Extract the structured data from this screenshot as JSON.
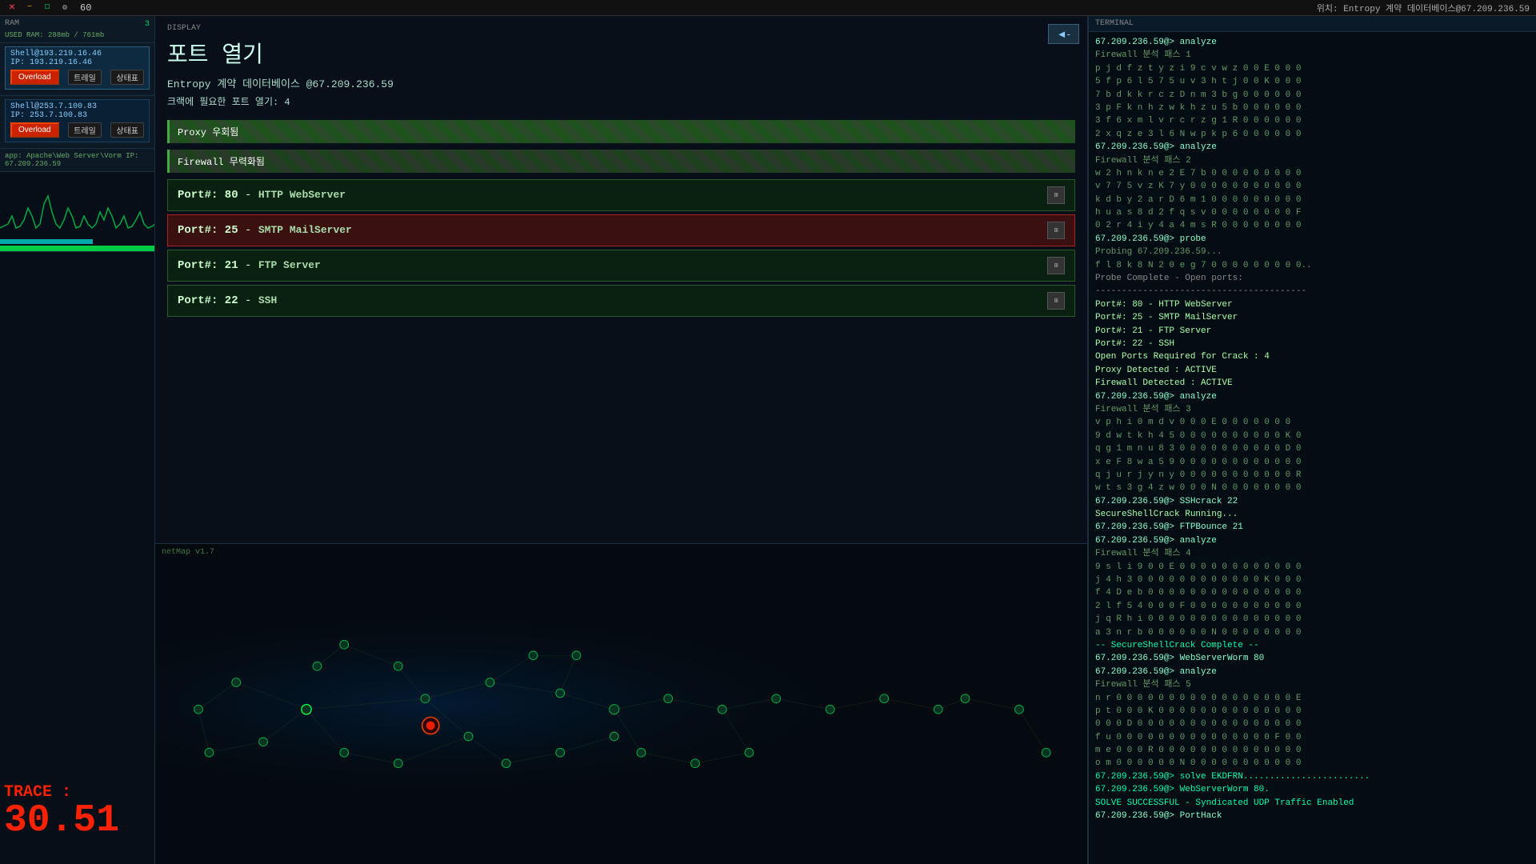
{
  "topbar": {
    "icons": [
      "×",
      "−",
      "□",
      "⚙"
    ],
    "counter": "60",
    "right_text": "위치: Entropy 계약 데이터베이스@67.209.236.59"
  },
  "sidebar": {
    "section_ram": "RAM",
    "ram_used": "USED RAM: 288mb / 761mb",
    "ram_number": "3",
    "host1": {
      "ip": "IP: 193.219.16.46",
      "name": "Shell@193.219.16.46"
    },
    "host2": {
      "ip": "IP: 253.7.100.83",
      "name": "Shell@253.7.100.83"
    },
    "btn_overload": "Overload",
    "btn_trace": "트레일",
    "btn_status": "상태표",
    "app_info": "app: Apache\\Web Server\\Vorm IP: 67.209.236.59"
  },
  "display": {
    "section_label": "DISPLAY",
    "title": "포트 열기",
    "target": "Entropy 계약 데이터베이스 @67.209.236.59",
    "crack_info": "크랙에 필요한 포트 열기: 4",
    "back_btn": "◄-",
    "proxy_label": "Proxy 우회됨",
    "firewall_label": "Firewall 무력화됨",
    "ports": [
      {
        "num": "80",
        "service": "HTTP WebServer",
        "active": false
      },
      {
        "num": "25",
        "service": "SMTP MailServer",
        "active": true
      },
      {
        "num": "21",
        "service": "FTP Server",
        "active": false
      },
      {
        "num": "22",
        "service": "SSH",
        "active": false
      }
    ]
  },
  "netmap": {
    "label": "netMap v1.7",
    "trace_label": "TRACE :",
    "trace_value": "30.51"
  },
  "terminal": {
    "section_label": "TERMINAL",
    "header_text": "위치: Entropy 계약 데이터베이스@67.209.236.59",
    "lines": [
      {
        "type": "cmd",
        "text": "67.209.236.59@> analyze"
      },
      {
        "type": "output",
        "text": "Firewall 분석 패스 1"
      },
      {
        "type": "output",
        "text": "p j d f z t y z i 9 c v w z 0 0 E 0 0 0"
      },
      {
        "type": "output",
        "text": "5 f p 6 l 5 7 5 u v 3 h t j 0 0 K 0 0 0"
      },
      {
        "type": "output",
        "text": "7 b d k k r c z D n m 3 b g 0 0 0 0 0 0"
      },
      {
        "type": "output",
        "text": "3 p F k n h z w k h z u 5 b 0 0 0 0 0 0"
      },
      {
        "type": "output",
        "text": "3 f 6 x m l v r c r z g 1 R 0 0 0 0 0 0"
      },
      {
        "type": "output",
        "text": "2 x q z e 3 l 6 N w p k p 6 0 0 0 0 0 0"
      },
      {
        "type": "cmd",
        "text": "67.209.236.59@> analyze"
      },
      {
        "type": "output",
        "text": "Firewall 분석 패스 2"
      },
      {
        "type": "output",
        "text": "w 2 h n k n e 2 E 7 b 0 0 0 0 0 0 0 0 0"
      },
      {
        "type": "output",
        "text": "v 7 7 5 v z K 7 y 0 0 0 0 0 0 0 0 0 0 0"
      },
      {
        "type": "output",
        "text": "k d b y 2 a r D 6 m 1 0 0 0 0 0 0 0 0 0"
      },
      {
        "type": "output",
        "text": "h u a s 8 d 2 f q s v 0 0 0 0 0 0 0 0 F"
      },
      {
        "type": "output",
        "text": "0 2 r 4 i y 4 a 4 m s R 0 0 0 0 0 0 0 0"
      },
      {
        "type": "cmd",
        "text": "67.209.236.59@> probe"
      },
      {
        "type": "output",
        "text": "Probing 67.209.236.59..."
      },
      {
        "type": "output",
        "text": "f l 8 k 8 N 2 0 e g 7 0 0 0 0 0 0 0 0 0.."
      },
      {
        "type": "section",
        "text": "Probe Complete - Open ports:"
      },
      {
        "type": "section",
        "text": "----------------------------------------"
      },
      {
        "type": "highlight",
        "text": "Port#: 80  -  HTTP WebServer"
      },
      {
        "type": "highlight",
        "text": "Port#: 25  -  SMTP MailServer"
      },
      {
        "type": "highlight",
        "text": "Port#: 21  -  FTP Server"
      },
      {
        "type": "highlight",
        "text": "Port#: 22  -  SSH"
      },
      {
        "type": "section",
        "text": ""
      },
      {
        "type": "highlight",
        "text": "Open Ports Required for Crack : 4"
      },
      {
        "type": "highlight",
        "text": "Proxy Detected : ACTIVE"
      },
      {
        "type": "highlight",
        "text": "Firewall Detected : ACTIVE"
      },
      {
        "type": "cmd",
        "text": "67.209.236.59@> analyze"
      },
      {
        "type": "output",
        "text": "Firewall 분석 패스 3"
      },
      {
        "type": "output",
        "text": "v p h i 0 m d v 0 0 0 E 0 0 0 0 0 0 0"
      },
      {
        "type": "output",
        "text": "9 d w t k h 4 5 0 0 0 0 0 0 0 0 0 0 K 0"
      },
      {
        "type": "output",
        "text": "q g 1 m n u 8 3 0 0 0 0 0 0 0 0 0 0 D 0"
      },
      {
        "type": "output",
        "text": "x e F 8 w a 5 9 0 0 0 0 0 0 0 0 0 0 0 0"
      },
      {
        "type": "output",
        "text": "q j u r j y n y 0 0 0 0 0 0 0 0 0 0 0 R"
      },
      {
        "type": "output",
        "text": "w t s 3 g 4 z w 0 0 0 N 0 0 0 0 0 0 0 0"
      },
      {
        "type": "cmd",
        "text": "67.209.236.59@> SSHcrack 22"
      },
      {
        "type": "highlight",
        "text": "SecureShellCrack Running..."
      },
      {
        "type": "cmd",
        "text": "67.209.236.59@> FTPBounce 21"
      },
      {
        "type": "cmd",
        "text": "67.209.236.59@> analyze"
      },
      {
        "type": "output",
        "text": "Firewall 분석 패스 4"
      },
      {
        "type": "output",
        "text": "9 s l i 9 0 0 E 0 0 0 0 0 0 0 0 0 0 0 0"
      },
      {
        "type": "output",
        "text": "j 4 h 3 0 0 0 0 0 0 0 0 0 0 0 0 K 0 0 0"
      },
      {
        "type": "output",
        "text": "f 4 D e b 0 0 0 0 0 0 0 0 0 0 0 0 0 0 0"
      },
      {
        "type": "output",
        "text": "2 l f 5 4 0 0 0 F 0 0 0 0 0 0 0 0 0 0 0"
      },
      {
        "type": "output",
        "text": "j q R h i 0 0 0 0 0 0 0 0 0 0 0 0 0 0 0"
      },
      {
        "type": "output",
        "text": "a 3 n r b 0 0 0 0 0 0 N 0 0 0 0 0 0 0 0"
      },
      {
        "type": "section",
        "text": ""
      },
      {
        "type": "success",
        "text": "-- SecureShellCrack Complete --"
      },
      {
        "type": "cmd",
        "text": "67.209.236.59@> WebServerWorm 80"
      },
      {
        "type": "cmd",
        "text": "67.209.236.59@> analyze"
      },
      {
        "type": "output",
        "text": "Firewall 분석 패스 5"
      },
      {
        "type": "output",
        "text": "n r 0 0 0 0 0 0 0 0 0 0 0 0 0 0 0 0 0 E"
      },
      {
        "type": "output",
        "text": "p t 0 0 0 K 0 0 0 0 0 0 0 0 0 0 0 0 0 0"
      },
      {
        "type": "output",
        "text": "0 0 0 D 0 0 0 0 0 0 0 0 0 0 0 0 0 0 0 0"
      },
      {
        "type": "output",
        "text": "f u 0 0 0 0 0 0 0 0 0 0 0 0 0 0 0 F 0 0"
      },
      {
        "type": "output",
        "text": "m e 0 0 0 R 0 0 0 0 0 0 0 0 0 0 0 0 0 0"
      },
      {
        "type": "output",
        "text": "o m 0 0 0 0 0 0 N 0 0 0 0 0 0 0 0 0 0 0"
      },
      {
        "type": "section",
        "text": ""
      },
      {
        "type": "success",
        "text": "67.209.236.59@> solve EKDFRN........................"
      },
      {
        "type": "success",
        "text": "67.209.236.59@> WebServerWorm 80."
      },
      {
        "type": "success",
        "text": "SOLVE SUCCESSFUL - Syndicated UDP Traffic Enabled"
      },
      {
        "type": "section",
        "text": ""
      },
      {
        "type": "prompt",
        "text": "67.209.236.59@> PortHack"
      }
    ]
  }
}
